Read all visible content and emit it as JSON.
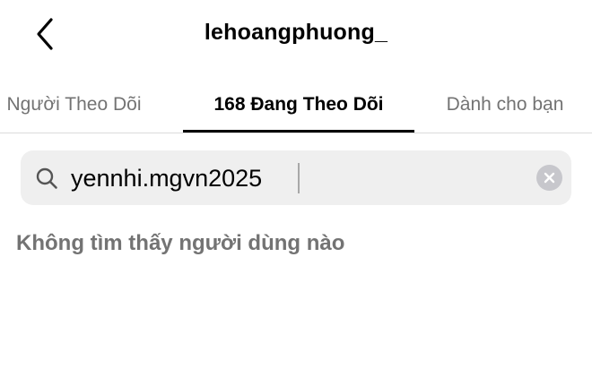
{
  "header": {
    "title": "lehoangphuong_",
    "back_icon": "chevron-left-icon"
  },
  "tabs": [
    {
      "label": "Người Theo Dõi",
      "active": false
    },
    {
      "label": "168 Đang Theo Dõi",
      "active": true
    },
    {
      "label": "Dành cho bạn",
      "active": false
    }
  ],
  "search": {
    "value": "yennhi.mgvn2025",
    "search_icon": "search-icon",
    "clear_icon": "clear-icon"
  },
  "results": {
    "empty_message": "Không tìm thấy người dùng nào"
  },
  "colors": {
    "background": "#ffffff",
    "text_primary": "#000000",
    "text_secondary": "#737373",
    "search_bg": "#efefef",
    "divider": "#dbdbdb"
  }
}
